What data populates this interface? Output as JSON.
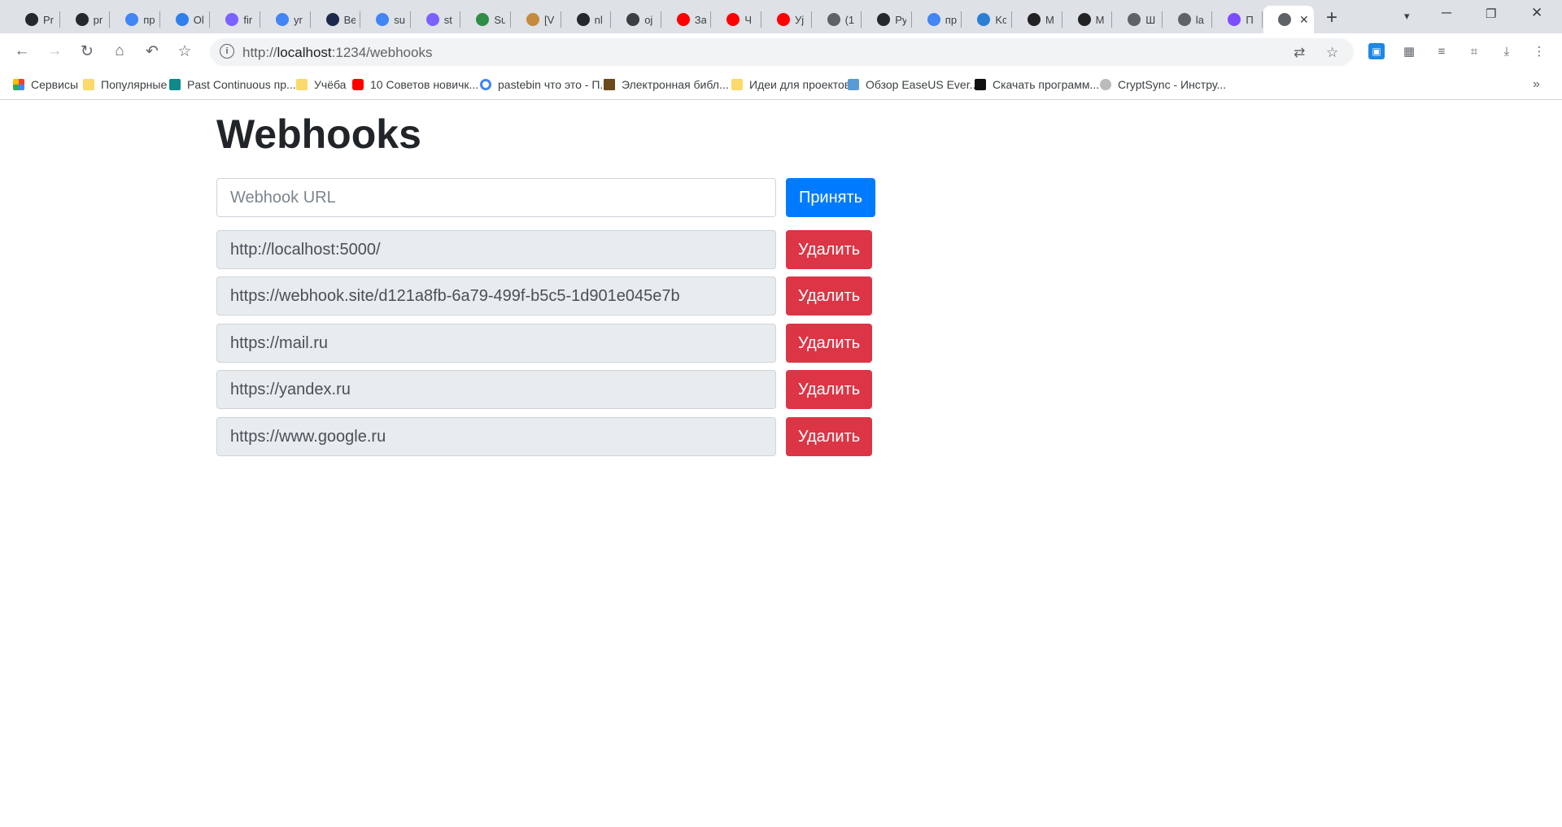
{
  "browser": {
    "tabs": [
      {
        "label": "Pr",
        "icon": "github-icon",
        "color": "#24292e"
      },
      {
        "label": "pr",
        "icon": "github-icon",
        "color": "#24292e"
      },
      {
        "label": "пр",
        "icon": "google-icon",
        "color": "#4285f4"
      },
      {
        "label": "Ol",
        "icon": "app-icon",
        "color": "#2f80ed"
      },
      {
        "label": "fir",
        "icon": "app-icon",
        "color": "#7b61ff"
      },
      {
        "label": "yr",
        "icon": "google-icon",
        "color": "#4285f4"
      },
      {
        "label": "Be",
        "icon": "r-icon",
        "color": "#1b2a4a"
      },
      {
        "label": "su",
        "icon": "google-icon",
        "color": "#4285f4"
      },
      {
        "label": "st",
        "icon": "app-icon",
        "color": "#7b61ff"
      },
      {
        "label": "Su",
        "icon": "gfg-icon",
        "color": "#2f8d46"
      },
      {
        "label": "[V",
        "icon": "dog-icon",
        "color": "#c58a3d"
      },
      {
        "label": "nl",
        "icon": "github-icon",
        "color": "#24292e"
      },
      {
        "label": "oj",
        "icon": "book-icon",
        "color": "#3c4043"
      },
      {
        "label": "За",
        "icon": "youtube-icon",
        "color": "#ff0000"
      },
      {
        "label": "Ч",
        "icon": "youtube-icon",
        "color": "#ff0000"
      },
      {
        "label": "Уј",
        "icon": "youtube-icon",
        "color": "#ff0000"
      },
      {
        "label": "(1",
        "icon": "anchor-icon",
        "color": "#5f6368"
      },
      {
        "label": "Py",
        "icon": "github-icon",
        "color": "#24292e"
      },
      {
        "label": "пр",
        "icon": "google-icon",
        "color": "#4285f4"
      },
      {
        "label": "Kc",
        "icon": "k-icon",
        "color": "#2a7fd4"
      },
      {
        "label": "M",
        "icon": "m-icon",
        "color": "#222222"
      },
      {
        "label": "M",
        "icon": "m-icon",
        "color": "#222222"
      },
      {
        "label": "Ш",
        "icon": "globe-icon",
        "color": "#5f6368"
      },
      {
        "label": "la",
        "icon": "globe-icon",
        "color": "#5f6368"
      },
      {
        "label": "П",
        "icon": "cube-icon",
        "color": "#7c4dff"
      },
      {
        "label": "",
        "icon": "globe-icon",
        "color": "#5f6368",
        "active": true
      }
    ],
    "url_prefix": "http://",
    "url_host": "localhost",
    "url_rest": ":1234/webhooks",
    "bookmarks": [
      {
        "label": "Сервисы",
        "icon": "apps-icon"
      },
      {
        "label": "Популярные",
        "icon": "folder-icon"
      },
      {
        "label": "Past Continuous пр...",
        "icon": "graduation-icon"
      },
      {
        "label": "Учёба",
        "icon": "folder-icon"
      },
      {
        "label": "10 Советов новичк...",
        "icon": "youtube-icon"
      },
      {
        "label": "pastebin что это - П...",
        "icon": "google-icon"
      },
      {
        "label": "Электронная библ...",
        "icon": "library-icon"
      },
      {
        "label": "Идеи для проектов",
        "icon": "folder-icon"
      },
      {
        "label": "Обзор EaseUS Ever...",
        "icon": "seven-icon"
      },
      {
        "label": "Скачать программ...",
        "icon": "one-icon"
      },
      {
        "label": "CryptSync - Инстру...",
        "icon": "lizard-icon"
      }
    ]
  },
  "page": {
    "title": "Webhooks",
    "input_placeholder": "Webhook URL",
    "accept_label": "Принять",
    "delete_label": "Удалить",
    "webhooks": [
      "http://localhost:5000/",
      "https://webhook.site/d121a8fb-6a79-499f-b5c5-1d901e045e7b",
      "https://mail.ru",
      "https://yandex.ru",
      "https://www.google.ru"
    ],
    "colors": {
      "primary": "#007bff",
      "danger": "#dc3545",
      "readonly_bg": "#e9ecef"
    }
  }
}
